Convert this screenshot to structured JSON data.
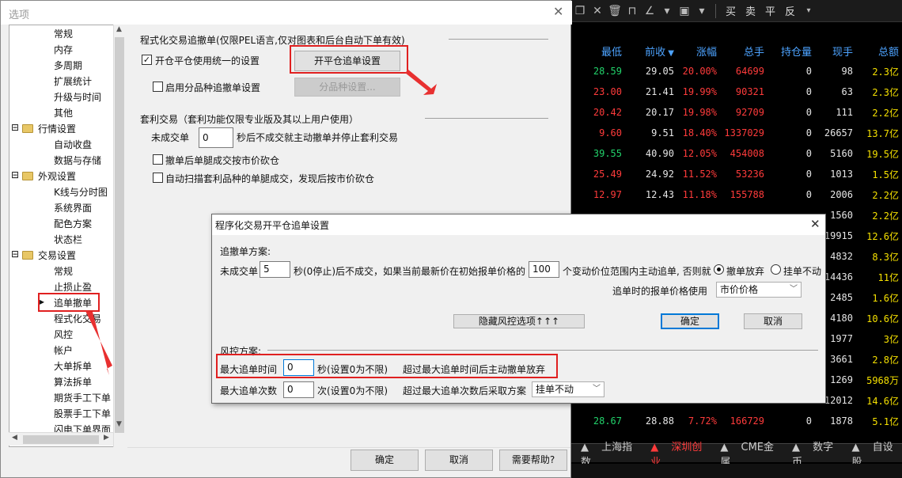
{
  "toolbar": {
    "buttons": [
      "买",
      "卖",
      "平",
      "反"
    ]
  },
  "quote_table": {
    "headers": [
      "最低",
      "前收",
      "涨幅",
      "总手",
      "持仓量",
      "现手",
      "总额"
    ],
    "rows": [
      {
        "low": "28.59",
        "prev": "29.05",
        "chg": "20.00%",
        "vol": "64699",
        "oi": "0",
        "cur": "98",
        "amt": "2.3亿"
      },
      {
        "low": "23.00",
        "prev": "21.41",
        "chg": "19.99%",
        "vol": "90321",
        "oi": "0",
        "cur": "63",
        "amt": "2.3亿"
      },
      {
        "low": "20.42",
        "prev": "20.17",
        "chg": "19.98%",
        "vol": "92709",
        "oi": "0",
        "cur": "111",
        "amt": "2.2亿"
      },
      {
        "low": "9.60",
        "prev": "9.51",
        "chg": "18.40%",
        "vol": "1337029",
        "oi": "0",
        "cur": "26657",
        "amt": "13.7亿"
      },
      {
        "low": "39.55",
        "prev": "40.90",
        "chg": "12.05%",
        "vol": "454008",
        "oi": "0",
        "cur": "5160",
        "amt": "19.5亿"
      },
      {
        "low": "25.49",
        "prev": "24.92",
        "chg": "11.52%",
        "vol": "53236",
        "oi": "0",
        "cur": "1013",
        "amt": "1.5亿"
      },
      {
        "low": "12.97",
        "prev": "12.43",
        "chg": "11.18%",
        "vol": "155788",
        "oi": "0",
        "cur": "2006",
        "amt": "2.2亿"
      }
    ],
    "partial_rows": [
      {
        "cur": "1560",
        "amt": "2.2亿"
      },
      {
        "cur": "19915",
        "amt": "12.6亿"
      },
      {
        "cur": "4832",
        "amt": "8.3亿"
      },
      {
        "cur": "14436",
        "amt": "11亿"
      },
      {
        "cur": "2485",
        "amt": "1.6亿"
      },
      {
        "cur": "4180",
        "amt": "10.6亿"
      },
      {
        "cur": "1977",
        "amt": "3亿"
      },
      {
        "cur": "3661",
        "amt": "2.8亿"
      },
      {
        "cur": "1269",
        "amt": "5968万"
      },
      {
        "cur": "12012",
        "amt": "14.6亿"
      }
    ],
    "last_row": {
      "low": "28.67",
      "prev": "28.88",
      "chg": "7.72%",
      "vol": "166729",
      "oi": "0",
      "cur": "1878",
      "amt": "5.1亿"
    }
  },
  "bottom_tabs": [
    "上海指数",
    "深圳创业",
    "CME金属",
    "数字币",
    "自设股"
  ],
  "options_window": {
    "title": "选项",
    "tree": [
      {
        "label": "常规",
        "level": 2
      },
      {
        "label": "内存",
        "level": 2
      },
      {
        "label": "多周期",
        "level": 2
      },
      {
        "label": "扩展统计",
        "level": 2
      },
      {
        "label": "升级与时间",
        "level": 2
      },
      {
        "label": "其他",
        "level": 2
      },
      {
        "label": "行情设置",
        "level": 1
      },
      {
        "label": "自动收盘",
        "level": 2
      },
      {
        "label": "数据与存储",
        "level": 2
      },
      {
        "label": "外观设置",
        "level": 1
      },
      {
        "label": "K线与分时图",
        "level": 2
      },
      {
        "label": "系统界面",
        "level": 2
      },
      {
        "label": "配色方案",
        "level": 2
      },
      {
        "label": "状态栏",
        "level": 2
      },
      {
        "label": "交易设置",
        "level": 1
      },
      {
        "label": "常规",
        "level": 2
      },
      {
        "label": "止损止盈",
        "level": 2
      },
      {
        "label": "追单撤单",
        "level": 2
      },
      {
        "label": "程式化交易",
        "level": 2
      },
      {
        "label": "风控",
        "level": 2
      },
      {
        "label": "帐户",
        "level": 2
      },
      {
        "label": "大单拆单",
        "level": 2
      },
      {
        "label": "算法拆单",
        "level": 2
      },
      {
        "label": "期货手工下单",
        "level": 2
      },
      {
        "label": "股票手工下单",
        "level": 2
      },
      {
        "label": "闪电下单界面",
        "level": 2
      }
    ],
    "section1_title": "程式化交易追撤单(仅限PEL语言,仅对图表和后台自动下单有效)",
    "unify_label": "开仓平仓使用统一的设置",
    "open_close_btn": "开平仓追单设置",
    "per_variety_label": "启用分品种追撤单设置",
    "per_variety_btn": "分品种设置...",
    "section2_title": "套利交易（套利功能仅限专业版及其以上用户使用）",
    "unfilled_prefix": "未成交单",
    "unfilled_value": "0",
    "unfilled_suffix": "秒后不成交就主动撤单并停止套利交易",
    "cb3_label": "撤单后单腿成交按市价砍仓",
    "cb4_label": "自动扫描套利品种的单腿成交，发现后按市价砍仓",
    "ok": "确定",
    "cancel": "取消",
    "help": "需要帮助?"
  },
  "dialog": {
    "title": "程序化交易开平仓追单设置",
    "chase_label": "追撤单方案:",
    "chase_prefix": "未成交单",
    "chase_secs": "5",
    "chase_mid": "秒(0停止)后不成交，如果当前最新价在初始报单价格的",
    "chase_ticks": "100",
    "chase_suffix": "个变动价位范围内主动追单, 否则就",
    "radio1": "撤单放弃",
    "radio2": "挂单不动",
    "price_label": "追单时的报单价格使用",
    "price_value": "市价价格",
    "hide_btn": "隐藏风控选项↑↑↑",
    "ok": "确定",
    "cancel": "取消",
    "risk_label": "风控方案:",
    "max_time_label": "最大追单时间",
    "max_time_value": "0",
    "max_time_unit": "秒(设置0为不限)",
    "max_time_desc": "超过最大追单时间后主动撤单放弃",
    "max_count_label": "最大追单次数",
    "max_count_value": "0",
    "max_count_unit": "次(设置0为不限)",
    "max_count_desc": "超过最大追单次数后采取方案",
    "max_count_select": "挂单不动"
  }
}
